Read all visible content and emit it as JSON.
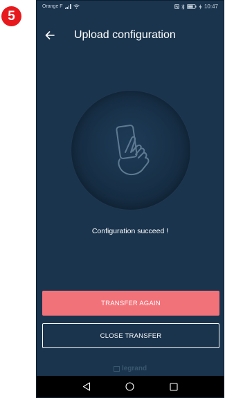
{
  "step": {
    "number": "5"
  },
  "statusbar": {
    "carrier": "Orange F",
    "time": "10:47"
  },
  "appbar": {
    "title": "Upload configuration"
  },
  "main": {
    "status_text": "Configuration succeed !"
  },
  "actions": {
    "transfer_again_label": "TRANSFER AGAIN",
    "close_transfer_label": "CLOSE TRANSFER"
  },
  "brand": {
    "name": "legrand"
  },
  "colors": {
    "background": "#1a344d",
    "primary_button": "#f2727a",
    "badge": "#e8191d"
  }
}
